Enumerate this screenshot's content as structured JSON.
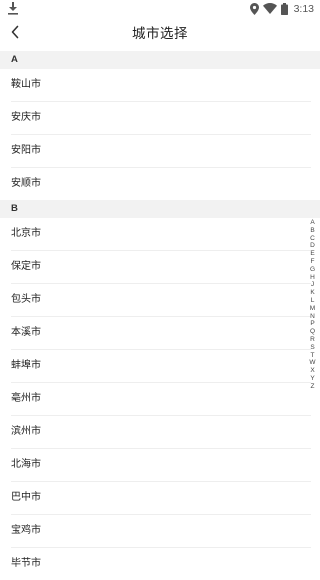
{
  "status_bar": {
    "time": "3:13",
    "left_icon": "download-icon",
    "right_icons": [
      "location-icon",
      "wifi-icon",
      "battery-icon"
    ]
  },
  "header": {
    "title": "城市选择",
    "back_icon": "chevron-left-icon"
  },
  "sections": [
    {
      "letter": "A",
      "cities": [
        "鞍山市",
        "安庆市",
        "安阳市",
        "安顺市"
      ]
    },
    {
      "letter": "B",
      "cities": [
        "北京市",
        "保定市",
        "包头市",
        "本溪市",
        "蚌埠市",
        "亳州市",
        "滨州市",
        "北海市",
        "巴中市",
        "宝鸡市",
        "毕节市"
      ]
    }
  ],
  "index_bar": [
    "A",
    "B",
    "C",
    "D",
    "E",
    "F",
    "G",
    "H",
    "J",
    "K",
    "L",
    "M",
    "N",
    "P",
    "Q",
    "R",
    "S",
    "T",
    "W",
    "X",
    "Y",
    "Z"
  ],
  "colors": {
    "section_bg": "#f2f2f2",
    "text": "#222222",
    "divider": "#eeeeee"
  }
}
